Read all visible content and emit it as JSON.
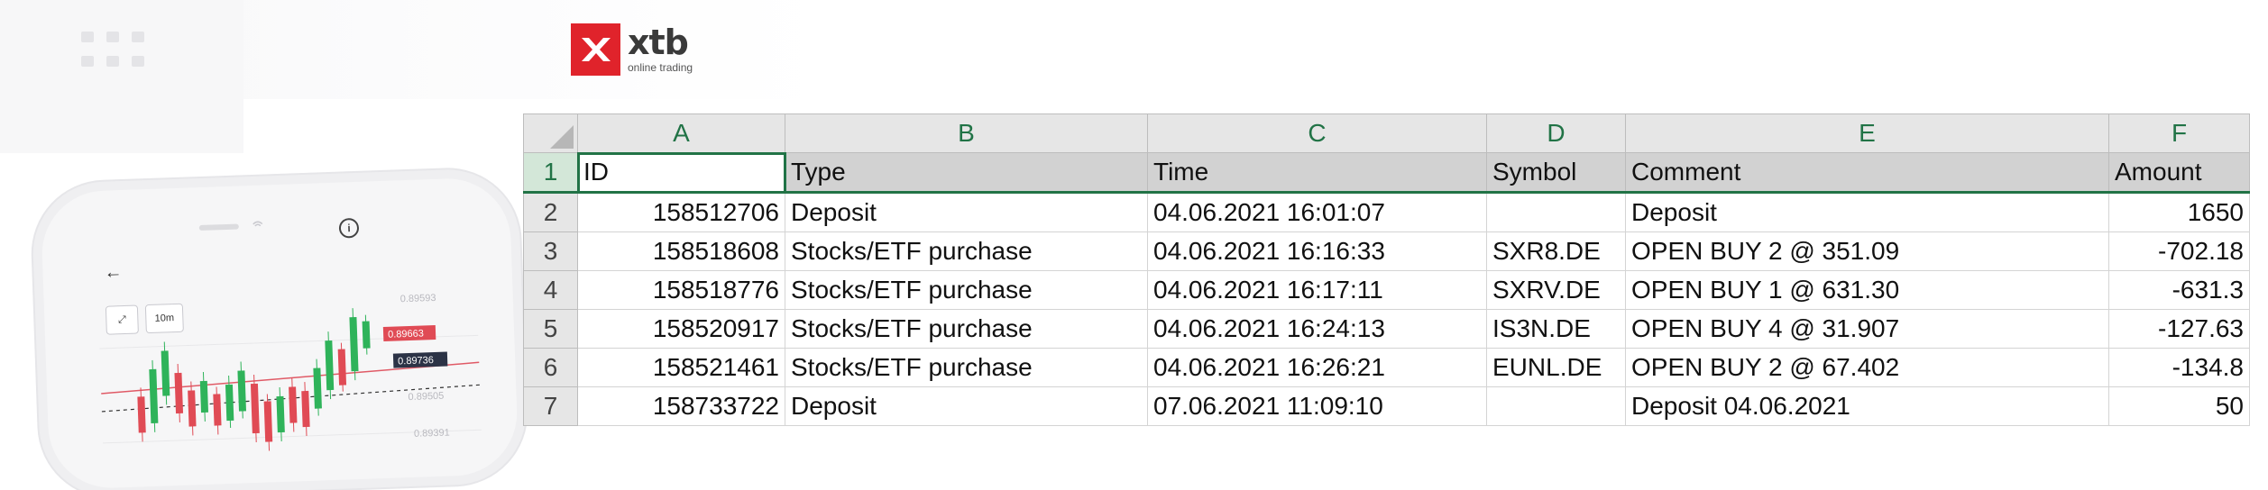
{
  "brand": {
    "name": "xtb",
    "tagline": "online trading",
    "accent": "#e0232b"
  },
  "phone": {
    "button_1": "ᐱᐸ\nᐳᐯ",
    "button_2": "10m",
    "price_labels": [
      "0.89593",
      "0.89663",
      "0.89736",
      "0.89505",
      "0.89391"
    ],
    "back_icon": "arrow-left-icon",
    "info_icon": "info-icon"
  },
  "spreadsheet": {
    "columns": [
      "A",
      "B",
      "C",
      "D",
      "E",
      "F"
    ],
    "row_numbers": [
      "1",
      "2",
      "3",
      "4",
      "5",
      "6",
      "7"
    ],
    "header": {
      "id": "ID",
      "type": "Type",
      "time": "Time",
      "symbol": "Symbol",
      "comment": "Comment",
      "amount": "Amount"
    },
    "rows": [
      {
        "id": "158512706",
        "type": "Deposit",
        "time": "04.06.2021 16:01:07",
        "symbol": "",
        "comment": "Deposit",
        "amount": "1650"
      },
      {
        "id": "158518608",
        "type": "Stocks/ETF purchase",
        "time": "04.06.2021 16:16:33",
        "symbol": "SXR8.DE",
        "comment": "OPEN BUY 2 @ 351.09",
        "amount": "-702.18"
      },
      {
        "id": "158518776",
        "type": "Stocks/ETF purchase",
        "time": "04.06.2021 16:17:11",
        "symbol": "SXRV.DE",
        "comment": "OPEN BUY 1 @ 631.30",
        "amount": "-631.3"
      },
      {
        "id": "158520917",
        "type": "Stocks/ETF purchase",
        "time": "04.06.2021 16:24:13",
        "symbol": "IS3N.DE",
        "comment": "OPEN BUY 4 @ 31.907",
        "amount": "-127.63"
      },
      {
        "id": "158521461",
        "type": "Stocks/ETF purchase",
        "time": "04.06.2021 16:26:21",
        "symbol": "EUNL.DE",
        "comment": "OPEN BUY 2 @ 67.402",
        "amount": "-134.8"
      },
      {
        "id": "158733722",
        "type": "Deposit",
        "time": "07.06.2021 11:09:10",
        "symbol": "",
        "comment": "Deposit 04.06.2021",
        "amount": "50"
      }
    ]
  }
}
